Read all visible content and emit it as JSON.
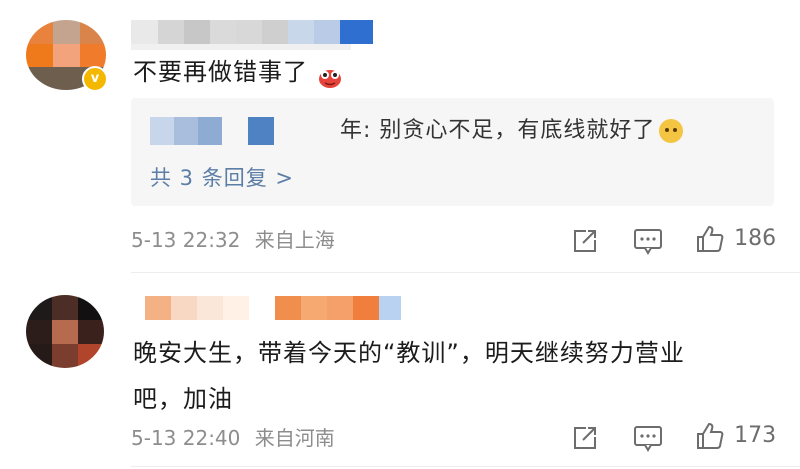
{
  "comments": [
    {
      "text": "不要再做错事了",
      "reply": {
        "text": "年: 别贪心不足，有底线就好了",
        "count_link": "共 3 条回复 >"
      },
      "timestamp": "5-13 22:32",
      "location": "来自上海",
      "likes": "186",
      "verified_badge": "v"
    },
    {
      "text_line1": "晚安大生，带着今天的“教训”，明天继续努力营业",
      "text_line2": "吧，加油",
      "timestamp": "5-13 22:40",
      "location": "来自河南",
      "likes": "173"
    }
  ],
  "icons": {
    "share": "share-icon",
    "comment": "comment-icon",
    "like": "thumbs-up-icon"
  },
  "colors": {
    "reply_link": "#5b7da6",
    "meta_text": "#8d8d8d",
    "reply_bg": "#f6f6f6",
    "verified": "#f5b800"
  }
}
